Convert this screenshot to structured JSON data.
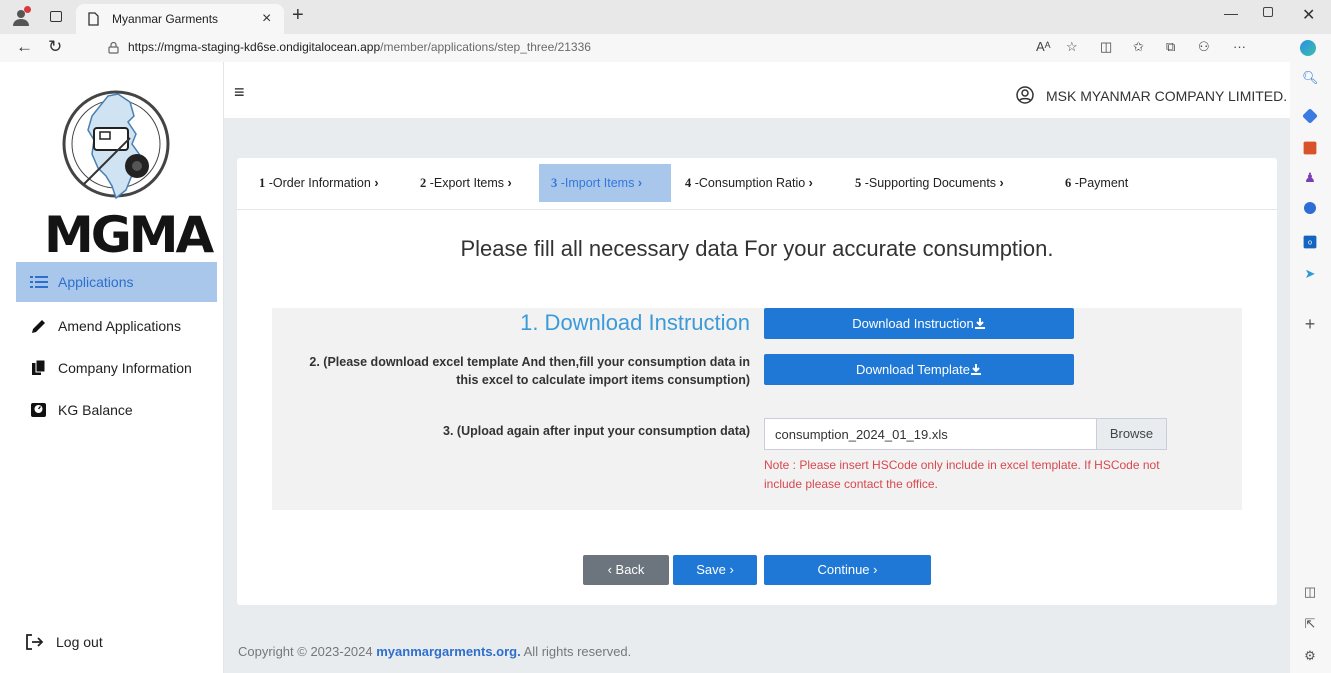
{
  "browser": {
    "tab_title": "Myanmar Garments",
    "url_host": "https://mgma-staging-kd6se.ondigitalocean.app",
    "url_path": "/member/applications/step_three/21336",
    "reader_label": "Aᴬ"
  },
  "sidebar": {
    "logo_text": "MGMA",
    "items": [
      {
        "label": "Applications",
        "active": true,
        "icon": "list-icon"
      },
      {
        "label": "Amend Applications",
        "active": false,
        "icon": "pencil-icon"
      },
      {
        "label": "Company Information",
        "active": false,
        "icon": "documents-icon"
      },
      {
        "label": "KG Balance",
        "active": false,
        "icon": "scale-icon"
      }
    ],
    "logout_label": "Log out"
  },
  "header": {
    "company_name": "MSK MYANMAR COMPANY LIMITED."
  },
  "steps": [
    {
      "num": "1",
      "label": " -Order Information",
      "arrow": " ›",
      "active": false
    },
    {
      "num": "2",
      "label": " -Export Items",
      "arrow": " ›",
      "active": false
    },
    {
      "num": "3",
      "label": " -Import Items",
      "arrow": " ›",
      "active": true
    },
    {
      "num": "4",
      "label": " -Consumption Ratio",
      "arrow": " ›",
      "active": false
    },
    {
      "num": "5",
      "label": " -Supporting Documents",
      "arrow": " ›",
      "active": false
    },
    {
      "num": "6",
      "label": " -Payment",
      "arrow": "",
      "active": false
    }
  ],
  "main": {
    "heading": "Please fill all necessary data For your accurate consumption.",
    "download_instruction_title": "1. Download Instruction",
    "download_instruction_button": "Download Instruction",
    "template_label_line1": "2. (Please download excel template And then,fill your consumption data in",
    "template_label_line2": "this excel to calculate import items consumption)",
    "download_template_button": "Download Template",
    "upload_label": "3. (Upload again after input your consumption data)",
    "file_name": "consumption_2024_01_19.xls",
    "browse_label": "Browse",
    "note_line1": "Note : Please insert HSCode only include in excel template. If HSCode not",
    "note_line2": "include please contact the office.",
    "back_label": "‹ Back",
    "save_label": "Save ›",
    "continue_label": "Continue ›"
  },
  "footer": {
    "prefix": "Copyright © 2023-2024 ",
    "link": "myanmargarments.org.",
    "suffix": " All rights reserved."
  },
  "colors": {
    "accent": "#1f78d6",
    "active_bg": "#a9c7ea",
    "note_red": "#d9484f",
    "back_gray": "#6c757d"
  }
}
